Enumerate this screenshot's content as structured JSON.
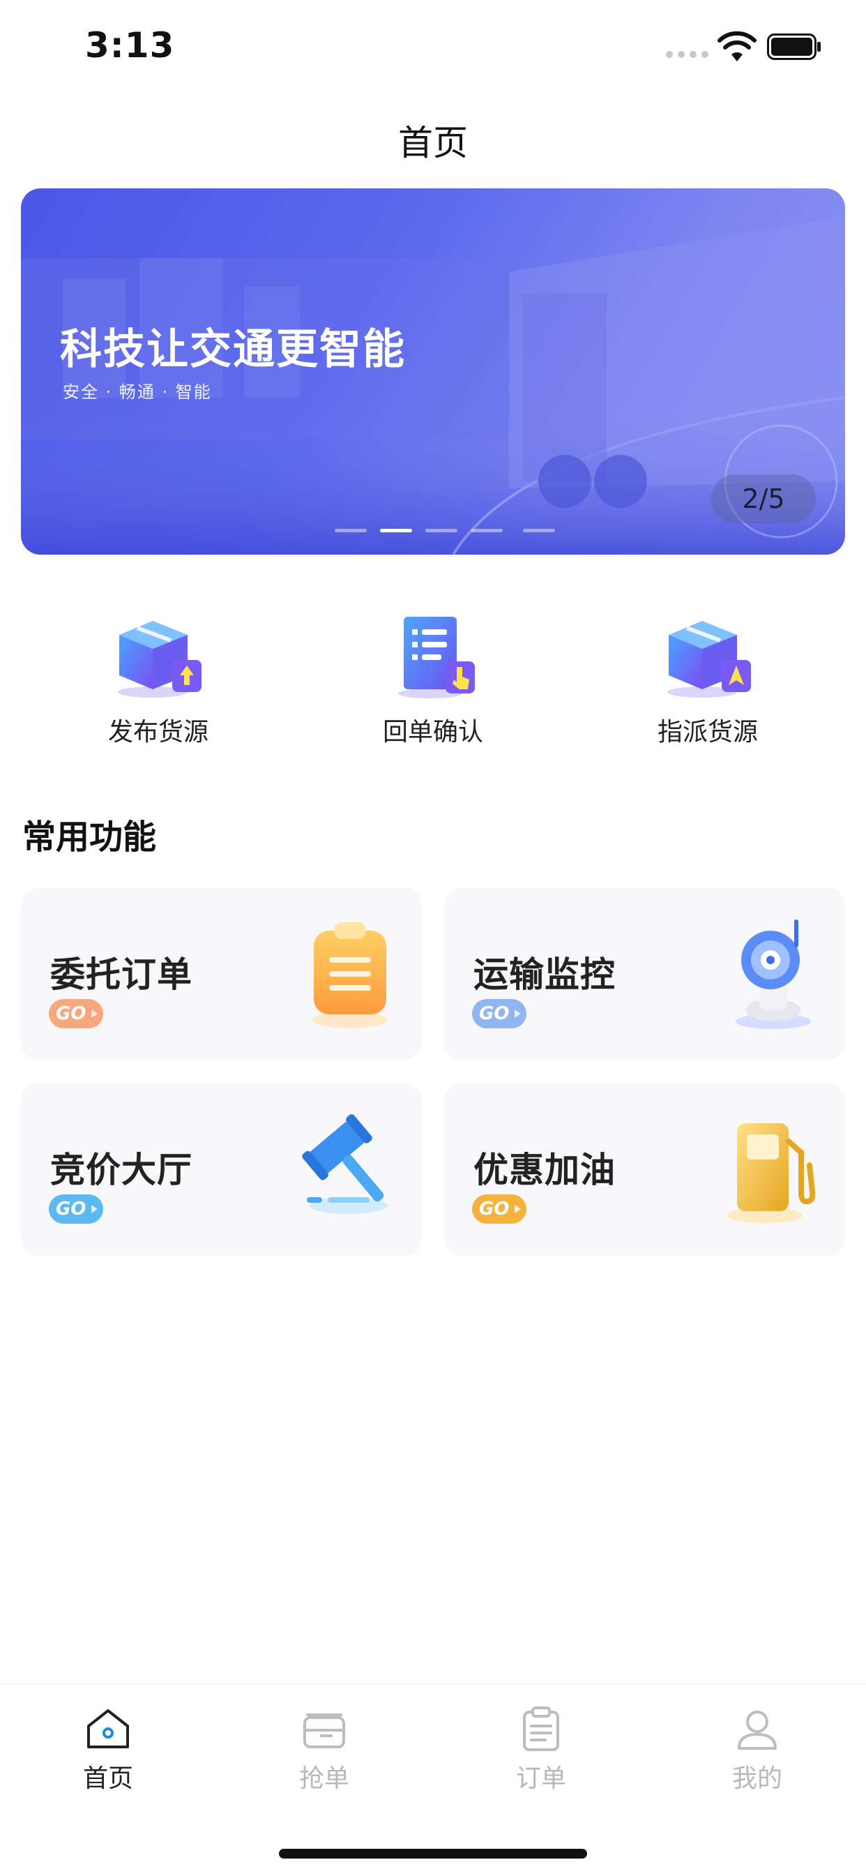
{
  "status_bar": {
    "time": "3:13"
  },
  "nav": {
    "title": "首页"
  },
  "banner": {
    "title": "科技让交通更智能",
    "subtitle": "安全 · 畅通 · 智能",
    "counter": "2/5",
    "active_index": 2,
    "total": 5
  },
  "quick_actions": [
    {
      "label": "发布货源",
      "icon": "publish-cargo-icon"
    },
    {
      "label": "回单确认",
      "icon": "receipt-confirm-icon"
    },
    {
      "label": "指派货源",
      "icon": "assign-cargo-icon"
    }
  ],
  "section": {
    "title": "常用功能"
  },
  "features": [
    {
      "title": "委托订单",
      "badge": "GO",
      "badge_color": "#f7a77c",
      "icon": "clipboard-icon"
    },
    {
      "title": "运输监控",
      "badge": "GO",
      "badge_color": "#8fb6f2",
      "icon": "camera-icon"
    },
    {
      "title": "竞价大厅",
      "badge": "GO",
      "badge_color": "#5cb8f0",
      "icon": "gavel-icon"
    },
    {
      "title": "优惠加油",
      "badge": "GO",
      "badge_color": "#f5b23d",
      "icon": "fuel-pump-icon"
    }
  ],
  "tabs": [
    {
      "label": "首页",
      "icon": "home-icon",
      "active": true
    },
    {
      "label": "抢单",
      "icon": "grab-order-icon",
      "active": false
    },
    {
      "label": "订单",
      "icon": "orders-icon",
      "active": false
    },
    {
      "label": "我的",
      "icon": "profile-icon",
      "active": false
    }
  ],
  "colors": {
    "primary": "#4b57e6",
    "accent_blue": "#1e88e5",
    "text": "#222222",
    "muted": "#b8b8b8"
  }
}
